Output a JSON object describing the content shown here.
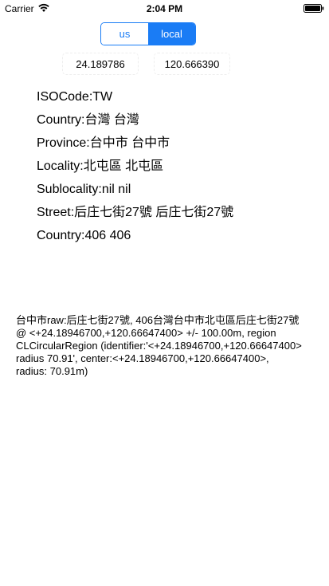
{
  "status_bar": {
    "carrier": "Carrier",
    "time": "2:04 PM",
    "wifi_icon": "wifi-icon",
    "battery_icon": "battery-icon"
  },
  "segmented": {
    "options": [
      "us",
      "local"
    ],
    "selected": "local",
    "accent_color": "#1a7cf5"
  },
  "coordinates": {
    "latitude": "24.189786",
    "longitude": "120.666390"
  },
  "info": {
    "iso_code": "ISOCode:TW",
    "country": "Country:台灣 台灣",
    "province": "Province:台中市 台中市",
    "locality": "Locality:北屯區 北屯區",
    "sublocality": "Sublocality:nil nil",
    "street": "Street:后庄七街27號 后庄七街27號",
    "postal": "Country:406 406"
  },
  "raw": "台中市raw:后庄七街27號, 406台灣台中市北屯區后庄七街27號 @ <+24.18946700,+120.66647400> +/- 100.00m, region CLCircularRegion (identifier:'<+24.18946700,+120.66647400> radius 70.91', center:<+24.18946700,+120.66647400>, radius: 70.91m)"
}
